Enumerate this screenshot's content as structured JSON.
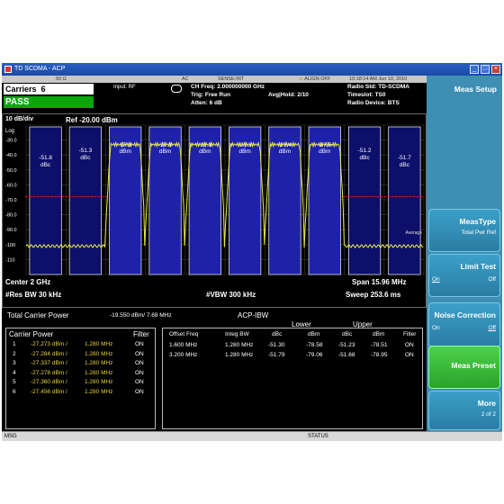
{
  "window": {
    "title": "TD SCDMA - ACP"
  },
  "status_strip": {
    "impedance": "50 Ω",
    "coupling": "AC",
    "sense": "SENSE:INT",
    "align": "ALIGN OFF",
    "datetime": "10:18:14 AM Jun 10, 2010"
  },
  "header": {
    "carriers_label": "Carriers",
    "carriers_value": "6",
    "result": "PASS",
    "input": "Input: RF",
    "ch_freq": "CH Freq: 2.000000000 GHz",
    "trig": "Trig: Free Run",
    "avg_hold": "Avg|Hold: 2/10",
    "atten": "Atten: 6 dB",
    "radio_std": "Radio Std: TD-SCDMA",
    "timeslot": "Timeslot: TS0",
    "radio_device": "Radio Device: BTS"
  },
  "plot": {
    "scale": "10 dB/div",
    "ref": "Ref -20.00 dBm",
    "log": "Log",
    "y_ticks": [
      "-30.0",
      "-40.0",
      "-50.0",
      "-60.0",
      "-70.0",
      "-80.0",
      "-90.0",
      "-100",
      "-110"
    ],
    "center": "Center  2 GHz",
    "span": "Span 15.96 MHz",
    "res_bw": "#Res BW  30 kHz",
    "vbw": "#VBW  300 kHz",
    "sweep": "Sweep  253.6 ms",
    "avg_label": "Average",
    "carrier_labels": [
      {
        "value": "-27.3",
        "unit": "dBm"
      },
      {
        "value": "-27.3",
        "unit": "dBm"
      },
      {
        "value": "-27.3",
        "unit": "dBm"
      },
      {
        "value": "-27.3",
        "unit": "dBm"
      },
      {
        "value": "-27.4",
        "unit": "dBm"
      },
      {
        "value": "-27.5",
        "unit": "dBm"
      }
    ],
    "offset_labels": [
      {
        "value": "-51.8",
        "unit": "dBc"
      },
      {
        "value": "-51.3",
        "unit": "dBc"
      },
      {
        "value": "-51.2",
        "unit": "dBc"
      },
      {
        "value": "-51.7",
        "unit": "dBc"
      }
    ],
    "colors": {
      "carrier_band": "#1e22a8",
      "offset_band": "#0d0f6a",
      "trace": "#e8e84a",
      "limit": "#c82020"
    }
  },
  "results": {
    "total_carrier_power_label": "Total Carrier Power",
    "total_carrier_power_value": "-19.550 dBm/ 7.68 MHz",
    "section_title": "ACP-IBW",
    "carrier_power_label": "Carrier Power",
    "filter_label": "Filter",
    "carrier_rows": [
      {
        "n": "1",
        "power": "-27.273 dBm /",
        "bw": "1.280 MHz",
        "filter": "ON"
      },
      {
        "n": "2",
        "power": "-27.284 dBm /",
        "bw": "1.280 MHz",
        "filter": "ON"
      },
      {
        "n": "3",
        "power": "-27.337 dBm /",
        "bw": "1.280 MHz",
        "filter": "ON"
      },
      {
        "n": "4",
        "power": "-27.278 dBm /",
        "bw": "1.280 MHz",
        "filter": "ON"
      },
      {
        "n": "5",
        "power": "-27.360 dBm /",
        "bw": "1.280 MHz",
        "filter": "ON"
      },
      {
        "n": "6",
        "power": "-27.456 dBm /",
        "bw": "1.280 MHz",
        "filter": "ON"
      }
    ],
    "lower_label": "Lower",
    "upper_label": "Upper",
    "col_headers": [
      "Offset Freq",
      "Integ BW",
      "dBc",
      "dBm",
      "dBc",
      "dBm",
      "Filter"
    ],
    "offset_rows": [
      {
        "freq": "1.600 MHz",
        "bw": "1.280 MHz",
        "l_dbc": "-51.30",
        "l_dbm": "-78.58",
        "u_dbc": "-51.23",
        "u_dbm": "-78.51",
        "filter": "ON"
      },
      {
        "freq": "3.200 MHz",
        "bw": "1.280 MHz",
        "l_dbc": "-51.79",
        "l_dbm": "-79.06",
        "u_dbc": "-51.68",
        "u_dbm": "-78.95",
        "filter": "ON"
      }
    ]
  },
  "softkeys": {
    "menu_title": "Meas Setup",
    "meastype_label": "MeasType",
    "meastype_value": "Total Pwr Ref",
    "limit_test_label": "Limit Test",
    "limit_test_on": "On",
    "limit_test_off": "Off",
    "noise_corr_label": "Noise Correction",
    "noise_corr_on": "On",
    "noise_corr_off": "Off",
    "meas_preset_label": "Meas Preset",
    "more_label": "More",
    "more_page": "2 of 2"
  },
  "msgbar": {
    "msg": "MSG",
    "status": "STATUS"
  }
}
